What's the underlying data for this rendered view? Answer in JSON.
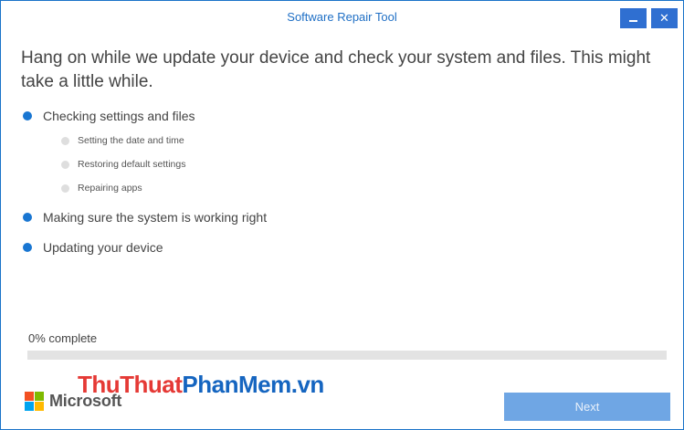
{
  "window": {
    "title": "Software Repair Tool",
    "accent_color": "#1976d2"
  },
  "heading": "Hang on while we update your device and check your system and files. This might take a little while.",
  "steps": [
    {
      "label": "Checking settings and files",
      "substeps": [
        "Setting the date and time",
        "Restoring default settings",
        "Repairing apps"
      ]
    },
    {
      "label": "Making sure the system is working right"
    },
    {
      "label": "Updating your device"
    }
  ],
  "progress": {
    "label": "0% complete",
    "value_percent": 0
  },
  "branding": {
    "logo_text": "Microsoft",
    "logo_colors": [
      "#f25022",
      "#7fba00",
      "#00a4ef",
      "#ffb900"
    ],
    "watermark_part1": "ThuThuat",
    "watermark_part2": "PhanMem.vn"
  },
  "buttons": {
    "minimize_icon": "minimize-icon",
    "close_icon": "close-icon",
    "next_label": "Next"
  }
}
